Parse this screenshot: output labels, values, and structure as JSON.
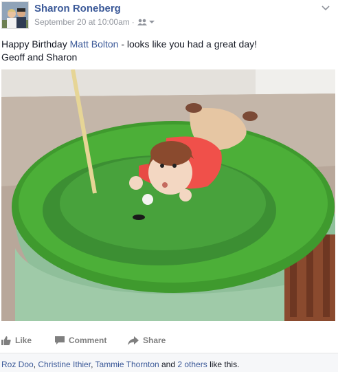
{
  "post": {
    "author": "Sharon Roneberg",
    "timestamp": "September 20 at 10:00am",
    "separator": "·",
    "audience_icon": "friends-icon",
    "message_part1": "Happy Birthday ",
    "mention": "Matt Bolton",
    "message_part2": " - looks like you had a great day!",
    "message_line2": "Geoff and Sharon",
    "photo_icon": "golf-cake-photo"
  },
  "actions": {
    "like_label": "Like",
    "comment_label": "Comment",
    "share_label": "Share"
  },
  "likes": {
    "person1": "Roz Doo",
    "comma1": ", ",
    "person2": "Christine Ithier",
    "comma2": ", ",
    "person3": "Tammie Thornton",
    "and_text": " and ",
    "others": "2 others",
    "suffix": " like this."
  },
  "colors": {
    "link": "#3b5998",
    "meta": "#90949c",
    "action": "#7f7f7f"
  }
}
